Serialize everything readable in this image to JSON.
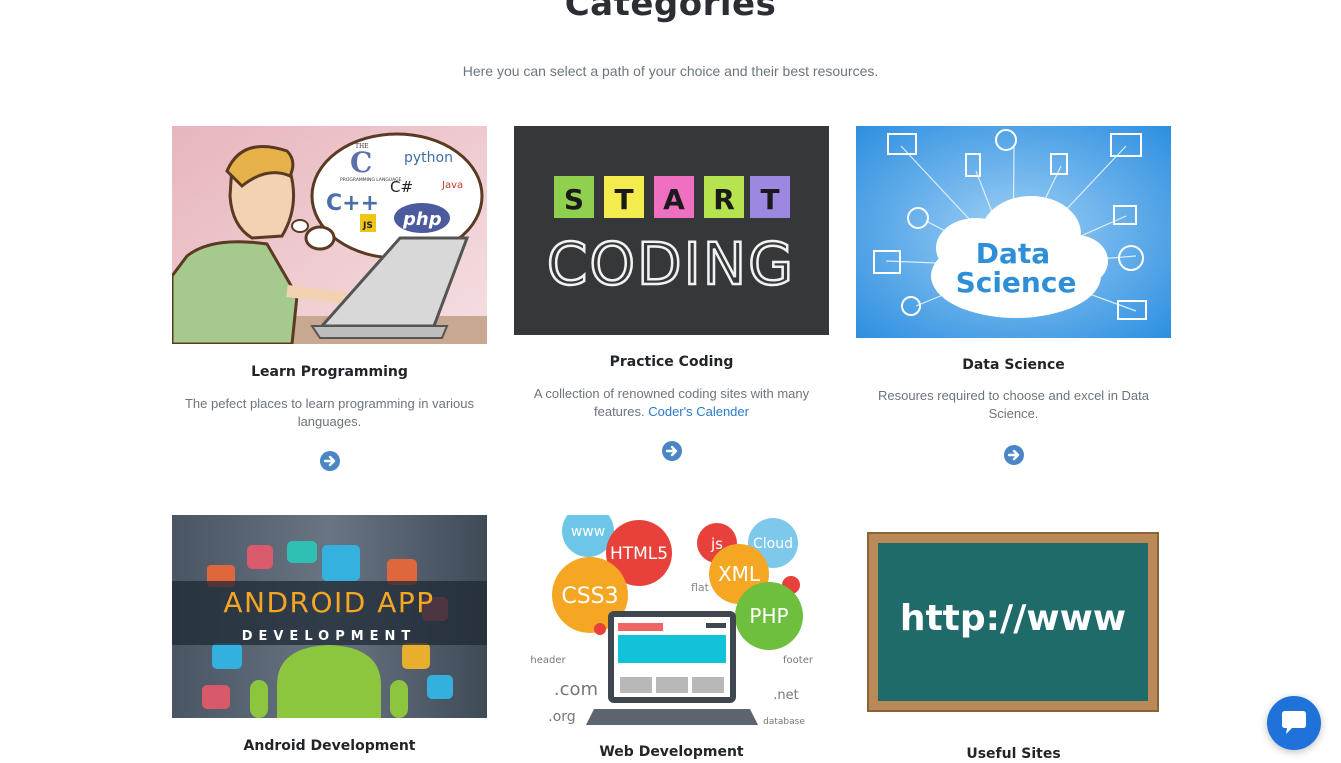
{
  "section": {
    "title": "Categories",
    "subtitle": "Here you can select a path of your choice and their best resources."
  },
  "cards": [
    {
      "title": "Learn Programming",
      "description": "The pefect places to learn programming in various languages.",
      "image_labels": [
        "THE",
        "C",
        "PROGRAMMING LANGUAGE",
        "python",
        "C#",
        "Java",
        "C++",
        "JS",
        "php"
      ],
      "button_icon": "arrow-circle-right-icon"
    },
    {
      "title": "Practice Coding",
      "description": "A collection of renowned coding sites with many features.",
      "link": "Coder's Calender",
      "image_labels": [
        "S",
        "T",
        "A",
        "R",
        "T",
        "CODING"
      ],
      "button_icon": "arrow-circle-right-icon"
    },
    {
      "title": "Data Science",
      "description": "Resoures required to choose and excel in Data Science.",
      "image_labels": [
        "Data",
        "Science"
      ],
      "button_icon": "arrow-circle-right-icon"
    },
    {
      "title": "Android Development",
      "image_labels": [
        "ANDROID APP",
        "DEVELOPMENT"
      ]
    },
    {
      "title": "Web Development",
      "image_labels": [
        "www",
        "HTML5",
        "js",
        "Cloud",
        "CSS3",
        "flat",
        "XML",
        "PHP",
        "header",
        "footer",
        ".com",
        ".net",
        ".org",
        "database"
      ]
    },
    {
      "title": "Useful Sites",
      "image_labels": [
        "http://www"
      ]
    }
  ],
  "chat": {
    "icon": "chat-icon"
  },
  "colors": {
    "accent": "#4a86c5",
    "chat": "#1e72d9",
    "text_muted": "#6c757d"
  }
}
